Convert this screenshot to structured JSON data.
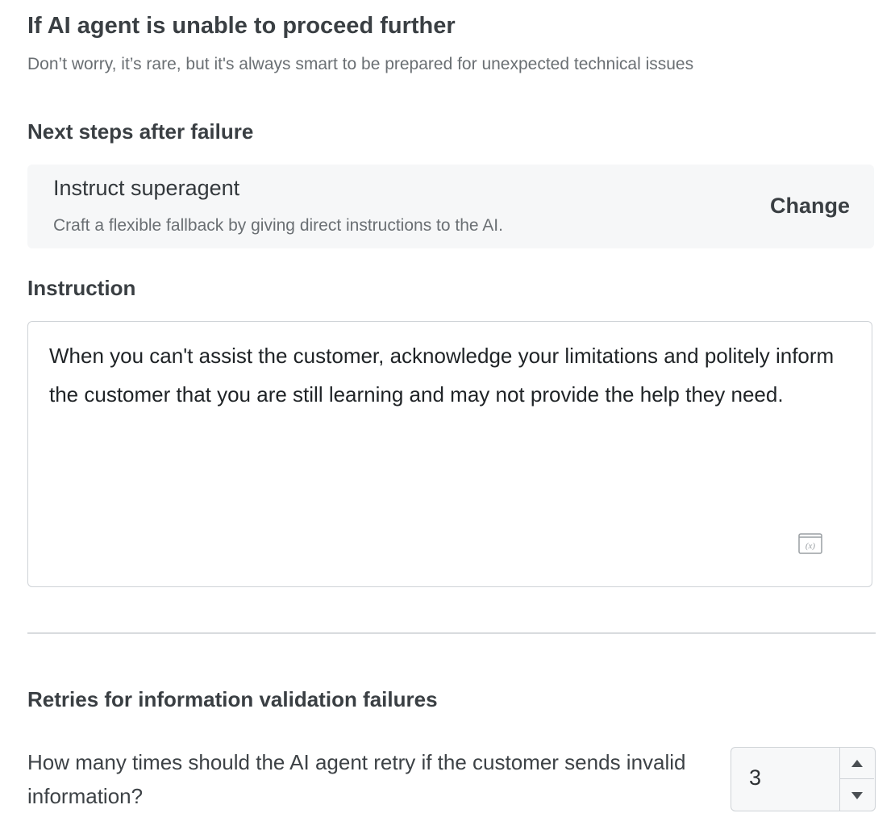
{
  "header": {
    "title": "If AI agent is unable to proceed further",
    "subtitle": "Don’t worry, it’s rare, but it's always smart to be prepared for unexpected technical issues"
  },
  "next_steps": {
    "heading": "Next steps after failure",
    "selected_title": "Instruct superagent",
    "selected_description": "Craft a flexible fallback by giving direct instructions to the AI.",
    "change_label": "Change"
  },
  "instruction": {
    "heading": "Instruction",
    "value": "When you can't assist the customer, acknowledge your limitations and politely inform the customer that you are still learning and may not provide the help they need.",
    "variable_icon": "variable-x-icon"
  },
  "retries": {
    "heading": "Retries for information validation failures",
    "question": "How many times should the AI agent retry if the customer sends invalid information?",
    "value": "3",
    "increment_icon": "triangle-up-icon",
    "decrement_icon": "triangle-down-icon"
  }
}
